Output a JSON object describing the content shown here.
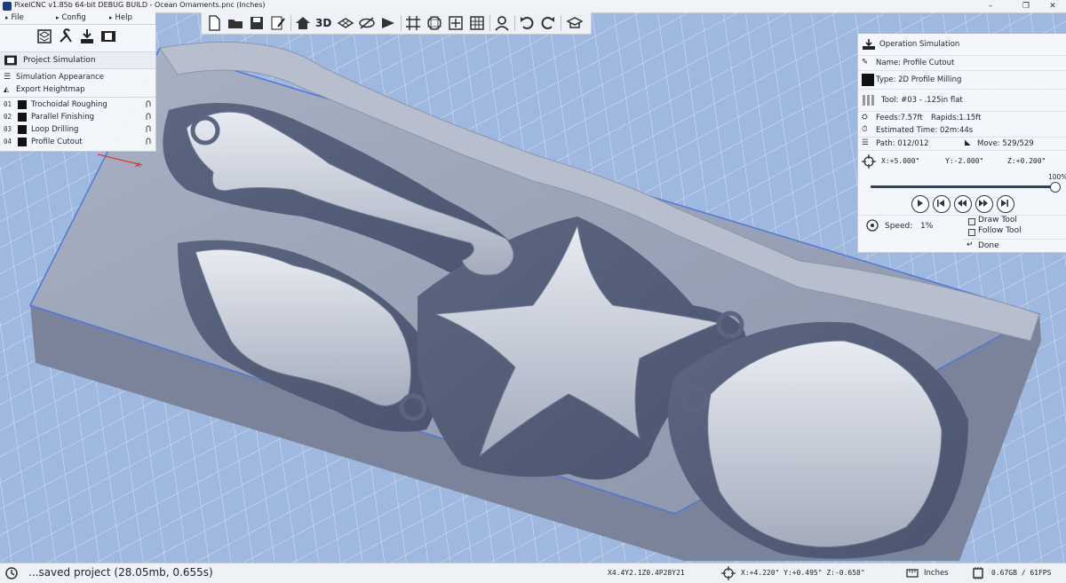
{
  "window": {
    "title": "PixelCNC v1.85b 64-bit DEBUG BUILD - Ocean Ornaments.pnc (Inches)",
    "minimize": "–",
    "maximize": "❐",
    "close": "✕"
  },
  "menu": [
    {
      "label": "File"
    },
    {
      "label": "Config"
    },
    {
      "label": "Help"
    }
  ],
  "toolbar": {
    "view_3d_label": "3D",
    "buttons": [
      "new-file",
      "open-folder",
      "save",
      "edit-project",
      "home-view",
      "3d-view",
      "wireframe-view",
      "hide-view",
      "cutaway-view",
      "grid",
      "snap-grid",
      "setup-box",
      "table-grid",
      "user-pair",
      "undo",
      "redo",
      "graduation-cap"
    ]
  },
  "left_panel": {
    "icons": [
      "layers-icon",
      "tools-icon",
      "export-icon",
      "film-icon"
    ],
    "header": "Project Simulation",
    "items": [
      {
        "label": "Simulation Appearance"
      },
      {
        "label": "Export Heightmap"
      }
    ],
    "operations": [
      {
        "num": "01",
        "label": "Trochoidal Roughing"
      },
      {
        "num": "02",
        "label": "Parallel Finishing"
      },
      {
        "num": "03",
        "label": "Loop Drilling"
      },
      {
        "num": "04",
        "label": "Profile Cutout"
      }
    ]
  },
  "right_panel": {
    "header": "Operation Simulation",
    "name": "Name: Profile Cutout",
    "type": "Type: 2D Profile Milling",
    "tool": "Tool: #03 - .125in flat",
    "feeds": "Feeds:7.57ft",
    "rapids": "Rapids:1.15ft",
    "estimated_time": "Estimated Time: 02m:44s",
    "path": "Path: 012/012",
    "move": "Move: 529/529",
    "coord_x": "X:+5.000\"",
    "coord_y": "Y:-2.000\"",
    "coord_z": "Z:+0.200\"",
    "progress_label": "100%",
    "progress": 1.0,
    "speed_label": "Speed:",
    "speed_value": "1%",
    "draw_tool": "Draw Tool",
    "follow_tool": "Follow Tool",
    "done": "Done"
  },
  "status": {
    "message": "...saved project (28.05mb, 0.655s)",
    "gcode": "X4.4Y2.1Z0.4P28Y21",
    "cursor": "X:+4.220\" Y:+0.495\" Z:-0.658\"",
    "units": "Inches",
    "memory": "0.67GB / 61FPS"
  },
  "colors": {
    "background": "#9fb8df",
    "stock": "#8e98ad",
    "panel": "#f6f8fb",
    "accent": "#2d3f63"
  }
}
